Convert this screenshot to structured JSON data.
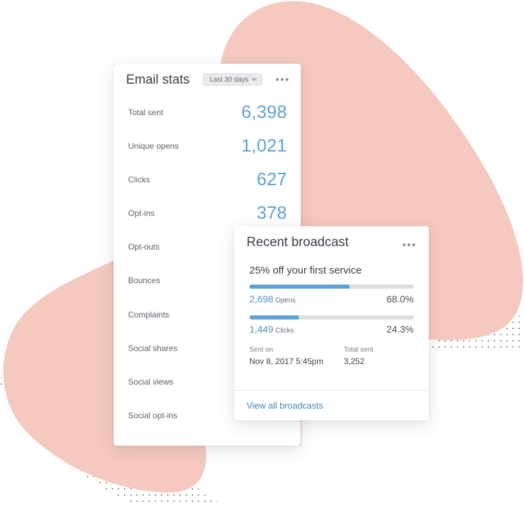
{
  "colors": {
    "blob": "#f5c9bf",
    "accent": "#5ea2d4",
    "link": "#3f86c0",
    "dots": "#8a8a8a"
  },
  "email_stats": {
    "title": "Email stats",
    "range": "Last 30 days",
    "more_icon": "more-horizontal-icon",
    "rows": [
      {
        "label": "Total sent",
        "value": "6,398"
      },
      {
        "label": "Unique opens",
        "value": "1,021"
      },
      {
        "label": "Clicks",
        "value": "627"
      },
      {
        "label": "Opt-ins",
        "value": "378"
      },
      {
        "label": "Opt-outs",
        "value": ""
      },
      {
        "label": "Bounces",
        "value": ""
      },
      {
        "label": "Complaints",
        "value": ""
      },
      {
        "label": "Social shares",
        "value": ""
      },
      {
        "label": "Social views",
        "value": ""
      },
      {
        "label": "Social opt-ins",
        "value": ""
      }
    ]
  },
  "broadcast": {
    "title": "Recent broadcast",
    "subject": "25% off your first service",
    "opens": {
      "count": "2,698",
      "unit": "Opens",
      "percent": "68.0%",
      "fraction": 0.61
    },
    "clicks": {
      "count": "1,449",
      "unit": "Clicks",
      "percent": "24.3%",
      "fraction": 0.3
    },
    "sent_on_label": "Sent on",
    "sent_on": "Nov 8, 2017 5:45pm",
    "total_sent_label": "Total sent",
    "total_sent": "3,252",
    "view_all": "View all broadcasts"
  }
}
